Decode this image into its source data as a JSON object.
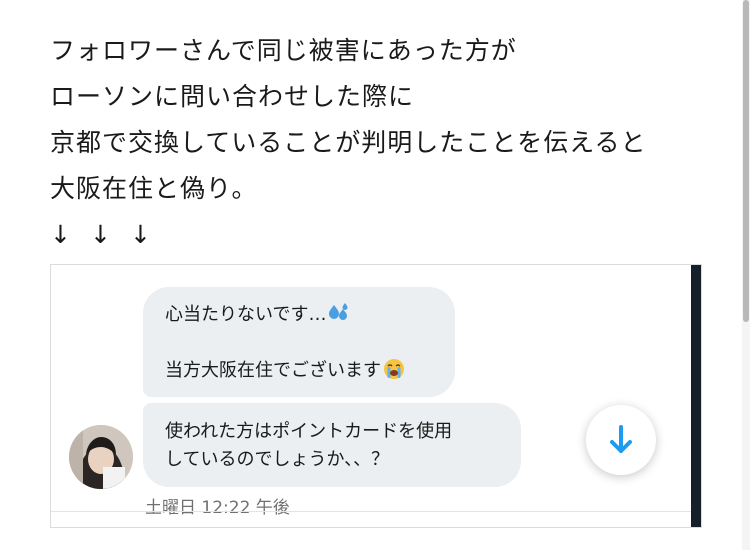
{
  "tweet": {
    "lines": [
      "フォロワーさんで同じ被害にあった方が",
      "ローソンに問い合わせした際に",
      "京都で交換していることが判明したことを伝えると",
      "大阪在住と偽り。"
    ],
    "arrows": [
      "↓",
      "↓",
      "↓"
    ]
  },
  "chat": {
    "messages": [
      {
        "line1": "心当たりないです…",
        "line1_emoji": "sweat-droplets-icon",
        "line2": "当方大阪在住でございます",
        "line2_emoji": "loudly-crying-face-icon"
      },
      {
        "line1": "使われた方はポイントカードを使用",
        "line2": "しているのでしょうか、、？"
      }
    ],
    "timestamp": "土曜日 12:22 午後",
    "scroll_button_icon": "arrow-down-icon",
    "accent_color": "#1d9bf0",
    "bubble_color": "#eceff1"
  }
}
